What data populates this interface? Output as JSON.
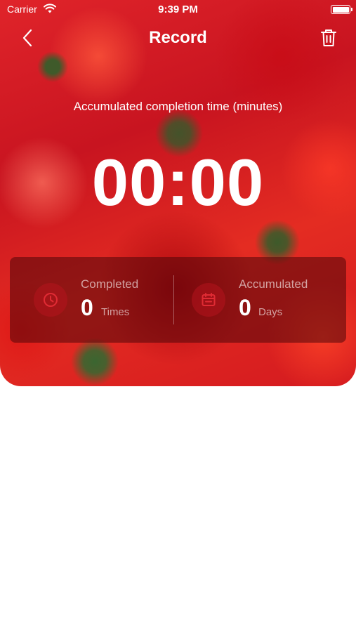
{
  "status_bar": {
    "carrier": "Carrier",
    "time": "9:39 PM",
    "wifi_icon": "wifi-icon",
    "battery_icon": "battery-icon"
  },
  "nav": {
    "title": "Record",
    "back_icon": "chevron-left-icon",
    "trash_icon": "trash-icon"
  },
  "summary": {
    "subtitle": "Accumulated completion time (minutes)",
    "timer": "00:00"
  },
  "stats": {
    "completed": {
      "label": "Completed",
      "value": "0",
      "unit": "Times",
      "icon": "clock-icon"
    },
    "accumulated": {
      "label": "Accumulated",
      "value": "0",
      "unit": "Days",
      "icon": "calendar-icon"
    }
  },
  "colors": {
    "accent": "#d41a1f",
    "text_on_accent": "#ffffff",
    "stat_panel": "#50050a"
  }
}
